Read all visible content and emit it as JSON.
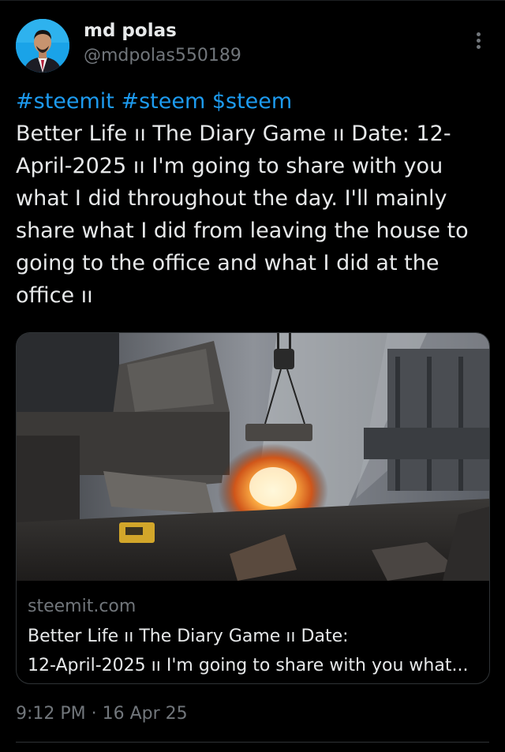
{
  "author": {
    "name": "md polas",
    "handle": "@mdpolas550189"
  },
  "tweet": {
    "tags": "#steemit #steem $steem",
    "text": "Better Life ıı The Diary Game ıı Date: 12-April-2025 ıı I'm going to share with you what I did throughout the day. I'll mainly share what I did from leaving the house to going to the office and what I did at the office ıı"
  },
  "card": {
    "domain": "steemit.com",
    "title_line1": "Better Life ıı The Diary Game ıı Date:",
    "title_line2": "12-April-2025 ıı I'm going to share with you what..."
  },
  "meta": {
    "timestamp": "9:12 PM · 16 Apr 25"
  },
  "colors": {
    "background": "#000000",
    "text": "#e7e9ea",
    "muted": "#71767b",
    "link": "#1d9bf0",
    "border": "#2f3336"
  },
  "icons": [
    "more-options-icon"
  ]
}
